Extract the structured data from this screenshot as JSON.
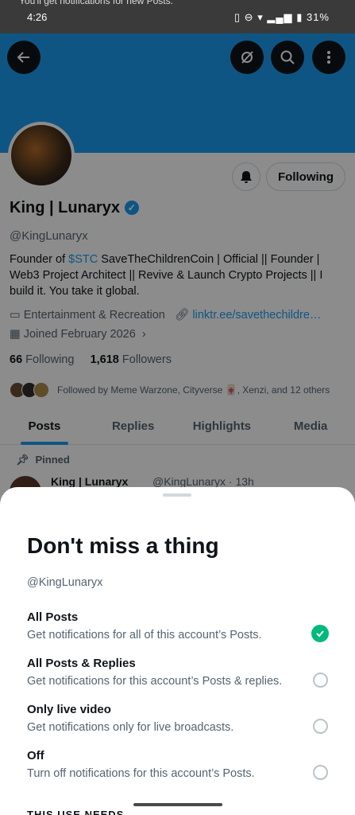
{
  "status_bar": {
    "peek_text": "You'll get notifications for new Posts.",
    "time": "4:26",
    "battery": "31%"
  },
  "profile": {
    "name": "King | Lunaryx",
    "handle": "@KingLunaryx",
    "following_button": "Following",
    "bio_prefix": "Founder of ",
    "bio_tag": "$STC",
    "bio_rest": " SaveTheChildrenCoin | Official || Founder | Web3 Project Architect || Revive & Launch Crypto Projects || I build it. You take it global.",
    "category": "Entertainment & Recreation",
    "link": "linktr.ee/savethechildre…",
    "joined": "Joined February 2026",
    "following_count": "66",
    "following_label": "Following",
    "followers_count": "1,618",
    "followers_label": "Followers",
    "followed_by": "Followed by Meme Warzone, Cityverse 🀄, Xenzi, and 12 others"
  },
  "tabs": [
    {
      "label": "Posts"
    },
    {
      "label": "Replies"
    },
    {
      "label": "Highlights"
    },
    {
      "label": "Media"
    }
  ],
  "pinned": {
    "label": "Pinned",
    "author": "King | Lunaryx",
    "handle_time": "@KingLunaryx · 13h"
  },
  "sheet": {
    "title": "Don't miss a thing",
    "handle": "@KingLunaryx",
    "options": [
      {
        "label": "All Posts",
        "desc": "Get notifications for all of this account’s Posts.",
        "selected": true
      },
      {
        "label": "All Posts & Replies",
        "desc": "Get notifications for this account’s Posts & replies.",
        "selected": false
      },
      {
        "label": "Only live video",
        "desc": "Get notifications only for live broadcasts.",
        "selected": false
      },
      {
        "label": "Off",
        "desc": "Turn off notifications for this account’s Posts.",
        "selected": false
      }
    ],
    "cutoff_text": "THIS USE NEEDS"
  },
  "colors": {
    "accent": "#1d9bf0",
    "selected_radio": "#00ba7c",
    "text_primary": "#0f1419",
    "text_secondary": "#536471"
  }
}
